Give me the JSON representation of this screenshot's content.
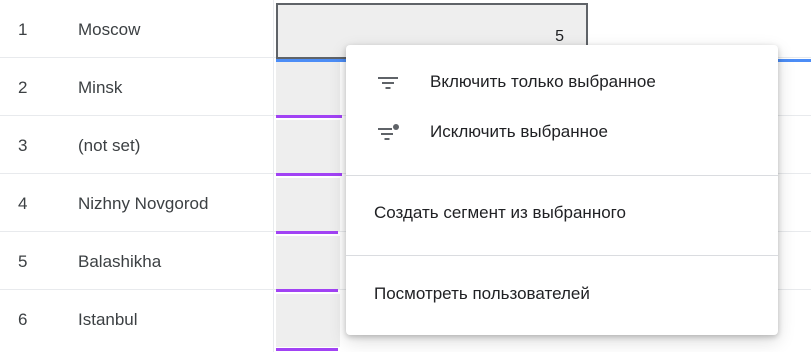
{
  "table": {
    "rows": [
      {
        "index": "1",
        "city": "Moscow"
      },
      {
        "index": "2",
        "city": "Minsk"
      },
      {
        "index": "3",
        "city": "(not set)"
      },
      {
        "index": "4",
        "city": "Nizhny Novgorod"
      },
      {
        "index": "5",
        "city": "Balashikha"
      },
      {
        "index": "6",
        "city": "Istanbul"
      }
    ],
    "selected_cell_value": "5"
  },
  "context_menu": {
    "include_label": "Включить только выбранное",
    "include_icon": "filter-icon",
    "exclude_label": "Исключить выбранное",
    "exclude_icon": "filter-exclude-icon",
    "create_segment_label": "Создать сегмент из выбранного",
    "view_users_label": "Посмотреть пользователей"
  },
  "colors": {
    "bar_purple": "#a142f4",
    "selection_blue": "#4c8df6"
  }
}
